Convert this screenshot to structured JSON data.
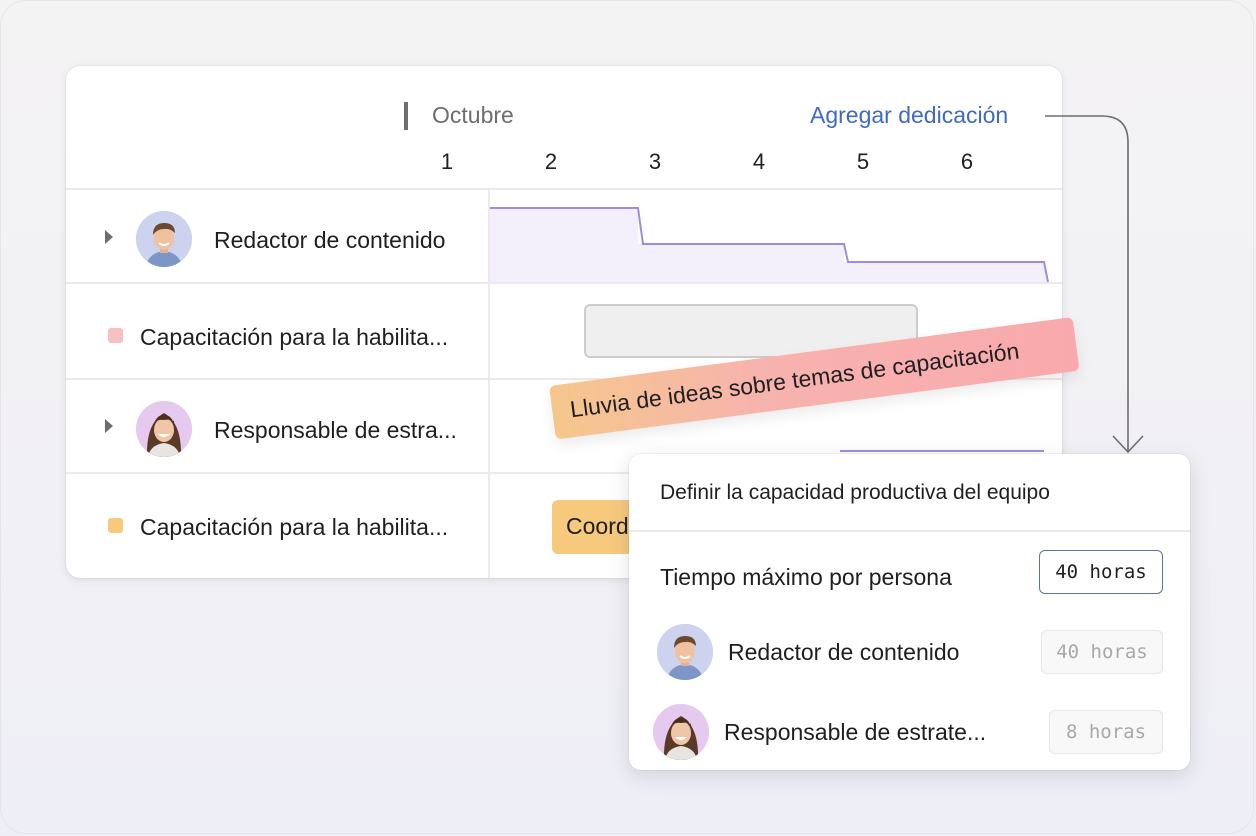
{
  "timeline": {
    "month": "Octubre",
    "add_dedication": "Agregar dedicación",
    "days": [
      "1",
      "2",
      "3",
      "4",
      "5",
      "6"
    ]
  },
  "rows": [
    {
      "label": "Redactor de contenido",
      "type": "person"
    },
    {
      "label": "Capacitación para la habilita...",
      "type": "task",
      "color": "#f6c1c1"
    },
    {
      "label": "Responsable de estra...",
      "type": "person"
    },
    {
      "label": "Capacitación para la habilita...",
      "type": "task",
      "color": "#f6c97d"
    }
  ],
  "workload_chart": {
    "line_color": "#9c8de0",
    "fill_color": "#f3f0fb"
  },
  "tasks": {
    "coord_bar_label": "Coordinar",
    "dragging_chip": "Lluvia de ideas sobre temas de capacitación"
  },
  "popup": {
    "title": "Definir la capacidad productiva del equipo",
    "max_time_label": "Tiempo máximo por persona",
    "max_time_value": "40 horas",
    "people": [
      {
        "name": "Redactor de contenido",
        "hours": "40 horas"
      },
      {
        "name": "Responsable de estrate...",
        "hours": "8 horas"
      }
    ]
  },
  "colors": {
    "link": "#3f6ac4",
    "chip_gradient_start": "#f6c78c",
    "chip_gradient_end": "#f9a9ad",
    "task_orange": "#f6c97d"
  }
}
